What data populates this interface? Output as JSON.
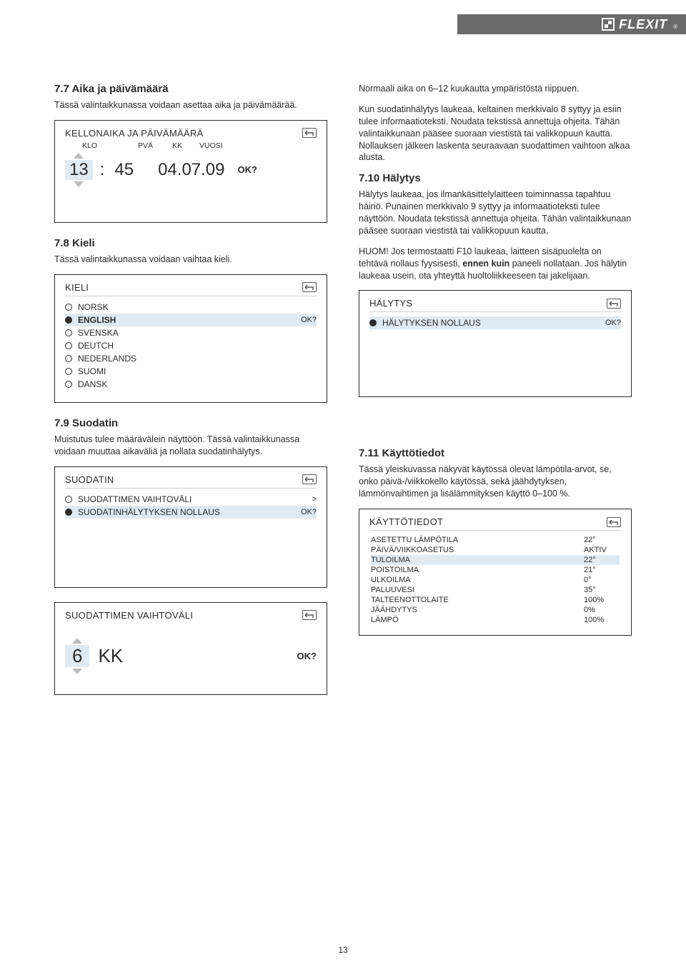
{
  "brand": "FLEXIT",
  "page_number": "13",
  "left": {
    "s77": {
      "heading": "7.7  Aika ja päivämäärä",
      "text": "Tässä valintaikkunassa voidaan asettaa aika ja päivämäärää.",
      "panel": {
        "title": "KELLONAIKA JA PÄIVÄMÄÄRÄ",
        "label_klo": "KLO",
        "label_pva": "PVÄ",
        "label_kk": "KK",
        "label_vuosi": "VUOSI",
        "time_hour": "13",
        "time_colon": ":",
        "time_min": "45",
        "date": "04.07.09",
        "ok": "OK?"
      }
    },
    "s78": {
      "heading": "7.8  Kieli",
      "text": "Tässä valintaikkunassa voidaan vaihtaa kieli.",
      "panel": {
        "title": "KIELI",
        "ok": "OK?",
        "items": [
          {
            "label": "NORSK",
            "selected": false
          },
          {
            "label": "ENGLISH",
            "selected": true
          },
          {
            "label": "SVENSKA",
            "selected": false
          },
          {
            "label": "DEUTCH",
            "selected": false
          },
          {
            "label": "NEDERLANDS",
            "selected": false
          },
          {
            "label": "SUOMI",
            "selected": false
          },
          {
            "label": "DANSK",
            "selected": false
          }
        ]
      }
    },
    "s79": {
      "heading": "7.9  Suodatin",
      "text": "Muistutus tulee määrävälein näyttöön. Tässä valintaikkunassa voidaan muuttaa aikaväliä ja nollata suodatinhälytys.",
      "panel1": {
        "title": "SUODATIN",
        "item1": {
          "label": "SUODATTIMEN VAIHTOVÄLI",
          "action": ">"
        },
        "item2": {
          "label": "SUODATINHÄLYTYKSEN NOLLAUS",
          "action": "OK?"
        }
      },
      "panel2": {
        "title": "SUODATTIMEN VAIHTOVÄLI",
        "value": "6",
        "unit": "KK",
        "ok": "OK?"
      }
    }
  },
  "right": {
    "para1": "Normaali aika on 6–12 kuukautta ympäristöstä riippuen.",
    "para2": "Kun suodatinhälytys laukeaa, keltainen merkkivalo 8 syttyy ja esiin tulee informaatioteksti. Noudata tekstissä annettuja ohjeita. Tähän valintaikkunaan pääsee suoraan viestistä tai valikkopuun kautta. Nollauksen jälkeen laskenta seuraavaan suodattimen vaihtoon alkaa alusta.",
    "s710": {
      "heading": "7.10 Hälytys",
      "text1": "Hälytys laukeaa, jos ilmankäsittelylaitteen toiminnassa tapahtuu häiriö. Punainen merkkivalo 9 syttyy ja informaatioteksti tulee näyttöön. Noudata tekstissä annettuja ohjeita. Tähän valintaikkunaan pääsee suoraan viestistä tai valikkopuun kautta.",
      "text2_a": "HUOM! Jos termostaatti F10 laukeaa, laitteen sisäpuolelta on tehtävä nollaus fyysisesti, ",
      "text2_b": "ennen kuin",
      "text2_c": " paneeli nollataan. Jos hälytin laukeaa usein, ota yhteyttä huoltoliikkeeseen tai jakelijaan.",
      "panel": {
        "title": "HÄLYTYS",
        "item": {
          "label": "HÄLYTYKSEN NOLLAUS",
          "action": "OK?"
        }
      }
    },
    "s711": {
      "heading": "7.11 Käyttötiedot",
      "text": "Tässä yleiskuvassa näkyvät käytössä olevat lämpötila-arvot, se, onko päivä-/viikkokello käytössä, sekä jäähdytyksen, lämmönvaihtimen ja lisälämmityksen käyttö 0–100 %.",
      "panel": {
        "title": "KÄYTTÖTIEDOT",
        "rows": [
          {
            "label": "ASETETTU LÄMPÖTILA",
            "value": "22°",
            "hl": false
          },
          {
            "label": "PÄIVÄ/VIIKKOASETUS",
            "value": "AKTIV",
            "hl": false
          },
          {
            "label": "TULOILMA",
            "value": "22°",
            "hl": true
          },
          {
            "label": "POISTOILMA",
            "value": "21°",
            "hl": false
          },
          {
            "label": "ULKOILMA",
            "value": "0°",
            "hl": false
          },
          {
            "label": "PALUUVESI",
            "value": "35°",
            "hl": false
          },
          {
            "label": "TALTEENOTTOLAITE",
            "value": "100%",
            "hl": false
          },
          {
            "label": "JÄÄHDYTYS",
            "value": "0%",
            "hl": false
          },
          {
            "label": "LÄMPÖ",
            "value": "100%",
            "hl": false
          }
        ]
      }
    }
  }
}
